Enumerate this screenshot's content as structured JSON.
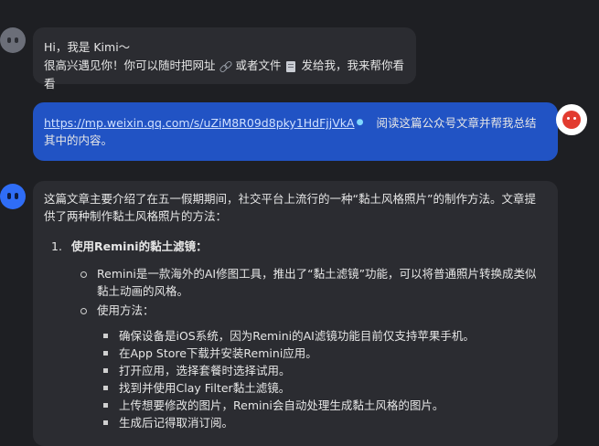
{
  "messages": {
    "greeting": {
      "line1": "Hi，我是 Kimi～",
      "line2_part1": "很高兴遇见你！你可以随时把网址",
      "line2_part2": "或者文件",
      "line2_part3": "发给我，我来帮你看看",
      "link_icon": "link-icon",
      "file_icon": "file-icon"
    },
    "user": {
      "url": "https://mp.weixin.qq.com/s/uZiM8R09d8pky1HdFjjVkA",
      "url_marker": "●",
      "text": "阅读这篇公众号文章并帮我总结其中的内容。"
    },
    "answer": {
      "intro": "这篇文章主要介绍了在五一假期期间，社交平台上流行的一种“黏土风格照片”的制作方法。文章提供了两种制作黏土风格照片的方法：",
      "method_number": "1.",
      "method_title": "使用Remini的黏土滤镜：",
      "bullets": [
        "Remini是一款海外的AI修图工具，推出了“黏土滤镜”功能，可以将普通照片转换成类似黏土动画的风格。",
        "使用方法："
      ],
      "steps": [
        "确保设备是iOS系统，因为Remini的AI滤镜功能目前仅支持苹果手机。",
        "在App Store下载并安装Remini应用。",
        "打开应用，选择套餐时选择试用。",
        "找到并使用Clay Filter黏土滤镜。",
        "上传想要修改的图片，Remini会自动处理生成黏土风格的图片。",
        "生成后记得取消订阅。"
      ]
    }
  },
  "colors": {
    "background": "#1e1f23",
    "assistant_bubble": "#2b2c31",
    "user_bubble": "#2153c4",
    "kimi_avatar": "#2f6df6"
  }
}
